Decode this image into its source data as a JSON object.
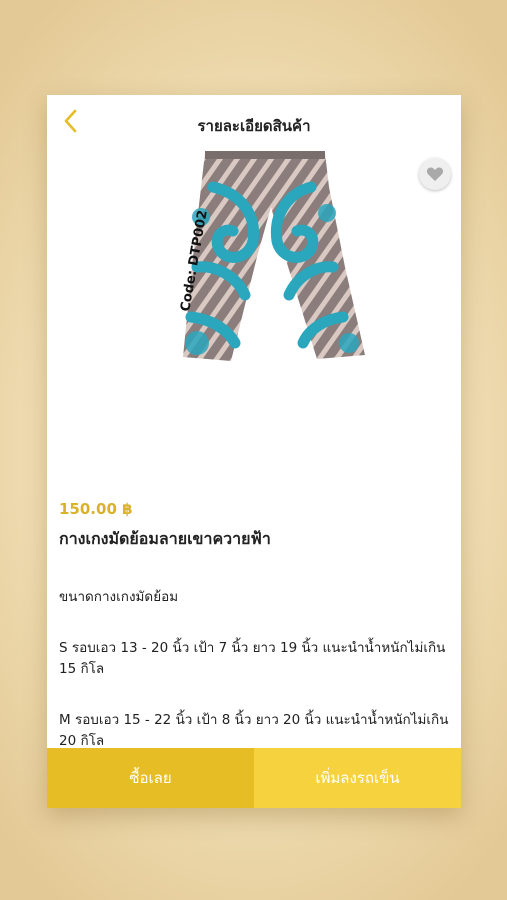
{
  "header": {
    "title": "รายละเอียดสินค้า",
    "back_icon": "chevron-left-icon",
    "accent_color": "#e7bd26"
  },
  "favorite": {
    "icon": "heart-icon"
  },
  "product": {
    "image_code_label": "Code: DTP002",
    "price": "150.00 ฿",
    "name": "กางเกงมัดย้อมลายเขาควายฟ้า",
    "description": [
      "ขนาดกางเกงมัดย้อม",
      "S รอบเอว 13 - 20 นิ้ว เป้า 7 นิ้ว ยาว 19 นิ้ว แนะนำน้ำหนักไม่เกิน 15 กิโล",
      "M รอบเอว 15 - 22 นิ้ว เป้า 8 นิ้ว ยาว 20 นิ้ว แนะนำน้ำหนักไม่เกิน 20 กิโล"
    ]
  },
  "actions": {
    "buy_now": "ซื้อเลย",
    "add_to_cart": "เพิ่มลงรถเข็น",
    "buy_color": "#e7bd26",
    "cart_color": "#f6d23f"
  }
}
